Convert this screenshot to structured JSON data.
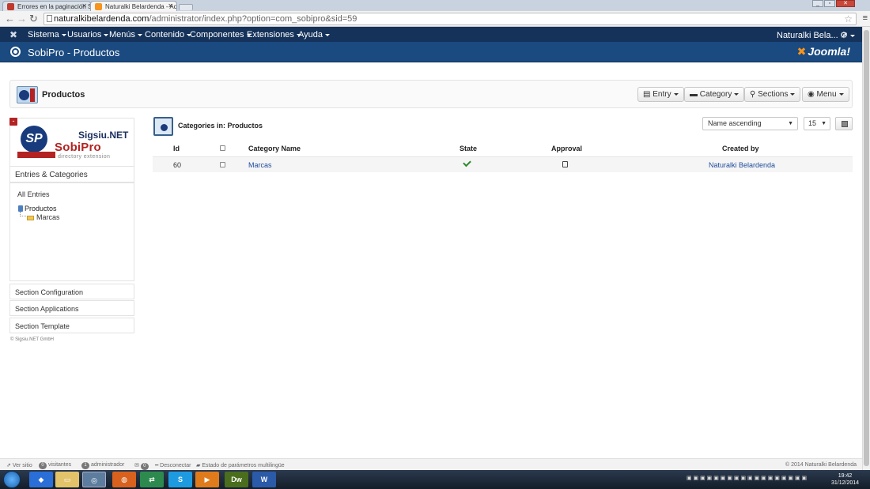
{
  "browser": {
    "tabs": [
      {
        "title": "Errores en la paginación S"
      },
      {
        "title": "Naturalki Belardenda - Ad"
      }
    ],
    "url_host": "naturalkibelardenda.com",
    "url_path": "/administrator/index.php?option=com_sobipro&sid=59"
  },
  "topnav": {
    "items": [
      "Sistema",
      "Usuarios",
      "Menús",
      "Contenido",
      "Componentes",
      "Extensiones",
      "Ayuda"
    ],
    "user": "Naturalki Bela..."
  },
  "header": {
    "title": "SobiPro - Productos",
    "brand": "Joomla!"
  },
  "toolbar": {
    "title": "Productos",
    "buttons": [
      "Entry",
      "Category",
      "Sections",
      "Menu"
    ]
  },
  "sidebar": {
    "logo_line1": "Sigsiu.NET",
    "logo_line2": "SobiPro",
    "logo_line3": "directory extension",
    "section_head": "Entries & Categories",
    "all_entries": "All Entries",
    "tree": [
      "Productos",
      "Marcas"
    ],
    "links": [
      "Section Configuration",
      "Section Applications",
      "Section Template"
    ],
    "footer": "© Sigsiu.NET GmbH"
  },
  "main": {
    "title": "Categories in: Productos",
    "sort_value": "Name ascending",
    "limit_value": "15",
    "columns": [
      "Id",
      "Category Name",
      "State",
      "Approval",
      "Created by"
    ],
    "rows": [
      {
        "id": "60",
        "name": "Marcas",
        "state": "published",
        "approval": "approved",
        "created_by": "Naturalki Belardenda"
      }
    ]
  },
  "statusbar": {
    "ver_sitio": "Ver sitio",
    "visitors_count": "0",
    "visitors_label": "visitantes",
    "admins_count": "1",
    "admins_label": "administrador",
    "messages_count": "0",
    "logout": "Desconectar",
    "multilang": "Estado de parámetros multilingüe",
    "copyright": "© 2014 Naturalki Belardenda"
  },
  "taskbar": {
    "time": "19:42",
    "date": "31/12/2014"
  },
  "colors": {
    "nav_bg": "#14325a",
    "header_bg": "#1a4a80",
    "link": "#1c4a9a",
    "sobipro_red": "#b32323"
  }
}
